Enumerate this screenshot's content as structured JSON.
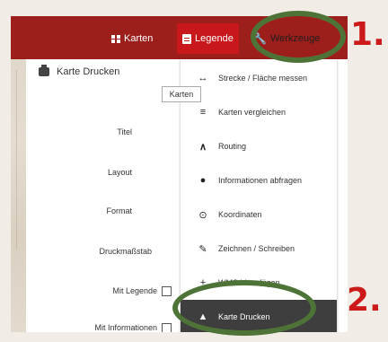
{
  "topbar": {
    "karten_label": "Karten",
    "legende_label": "Legende",
    "werkzeuge_label": "Werkzeuge"
  },
  "panel": {
    "title": "Karte Drucken",
    "fields": {
      "titel": "Titel",
      "layout": "Layout",
      "format": "Format",
      "druckmassstab": "Druckmaßstab",
      "mit_legende": "Mit Legende",
      "mit_informationen": "Mit Informationen"
    }
  },
  "tooltip": "Karten",
  "menu": {
    "items": [
      {
        "label": "Strecke / Fläche messen",
        "icon": "ruler-icon"
      },
      {
        "label": "Karten vergleichen",
        "icon": "list-icon"
      },
      {
        "label": "Routing",
        "icon": "road-icon"
      },
      {
        "label": "Informationen abfragen",
        "icon": "info-icon"
      },
      {
        "label": "Koordinaten",
        "icon": "crosshair-icon"
      },
      {
        "label": "Zeichnen / Schreiben",
        "icon": "pencil-icon"
      },
      {
        "label": "WMS hinzufügen",
        "icon": "plus-icon"
      },
      {
        "label": "Karte Drucken",
        "icon": "printer-icon",
        "active": true
      }
    ]
  },
  "callouts": {
    "step1": "1.",
    "step2": "2."
  },
  "colors": {
    "topbar": "#9d1f1b",
    "legende_tab": "#c9181b",
    "highlight_ring": "#4e7337",
    "callout": "#cc1a1a",
    "active_menu": "#3e3e3e"
  }
}
